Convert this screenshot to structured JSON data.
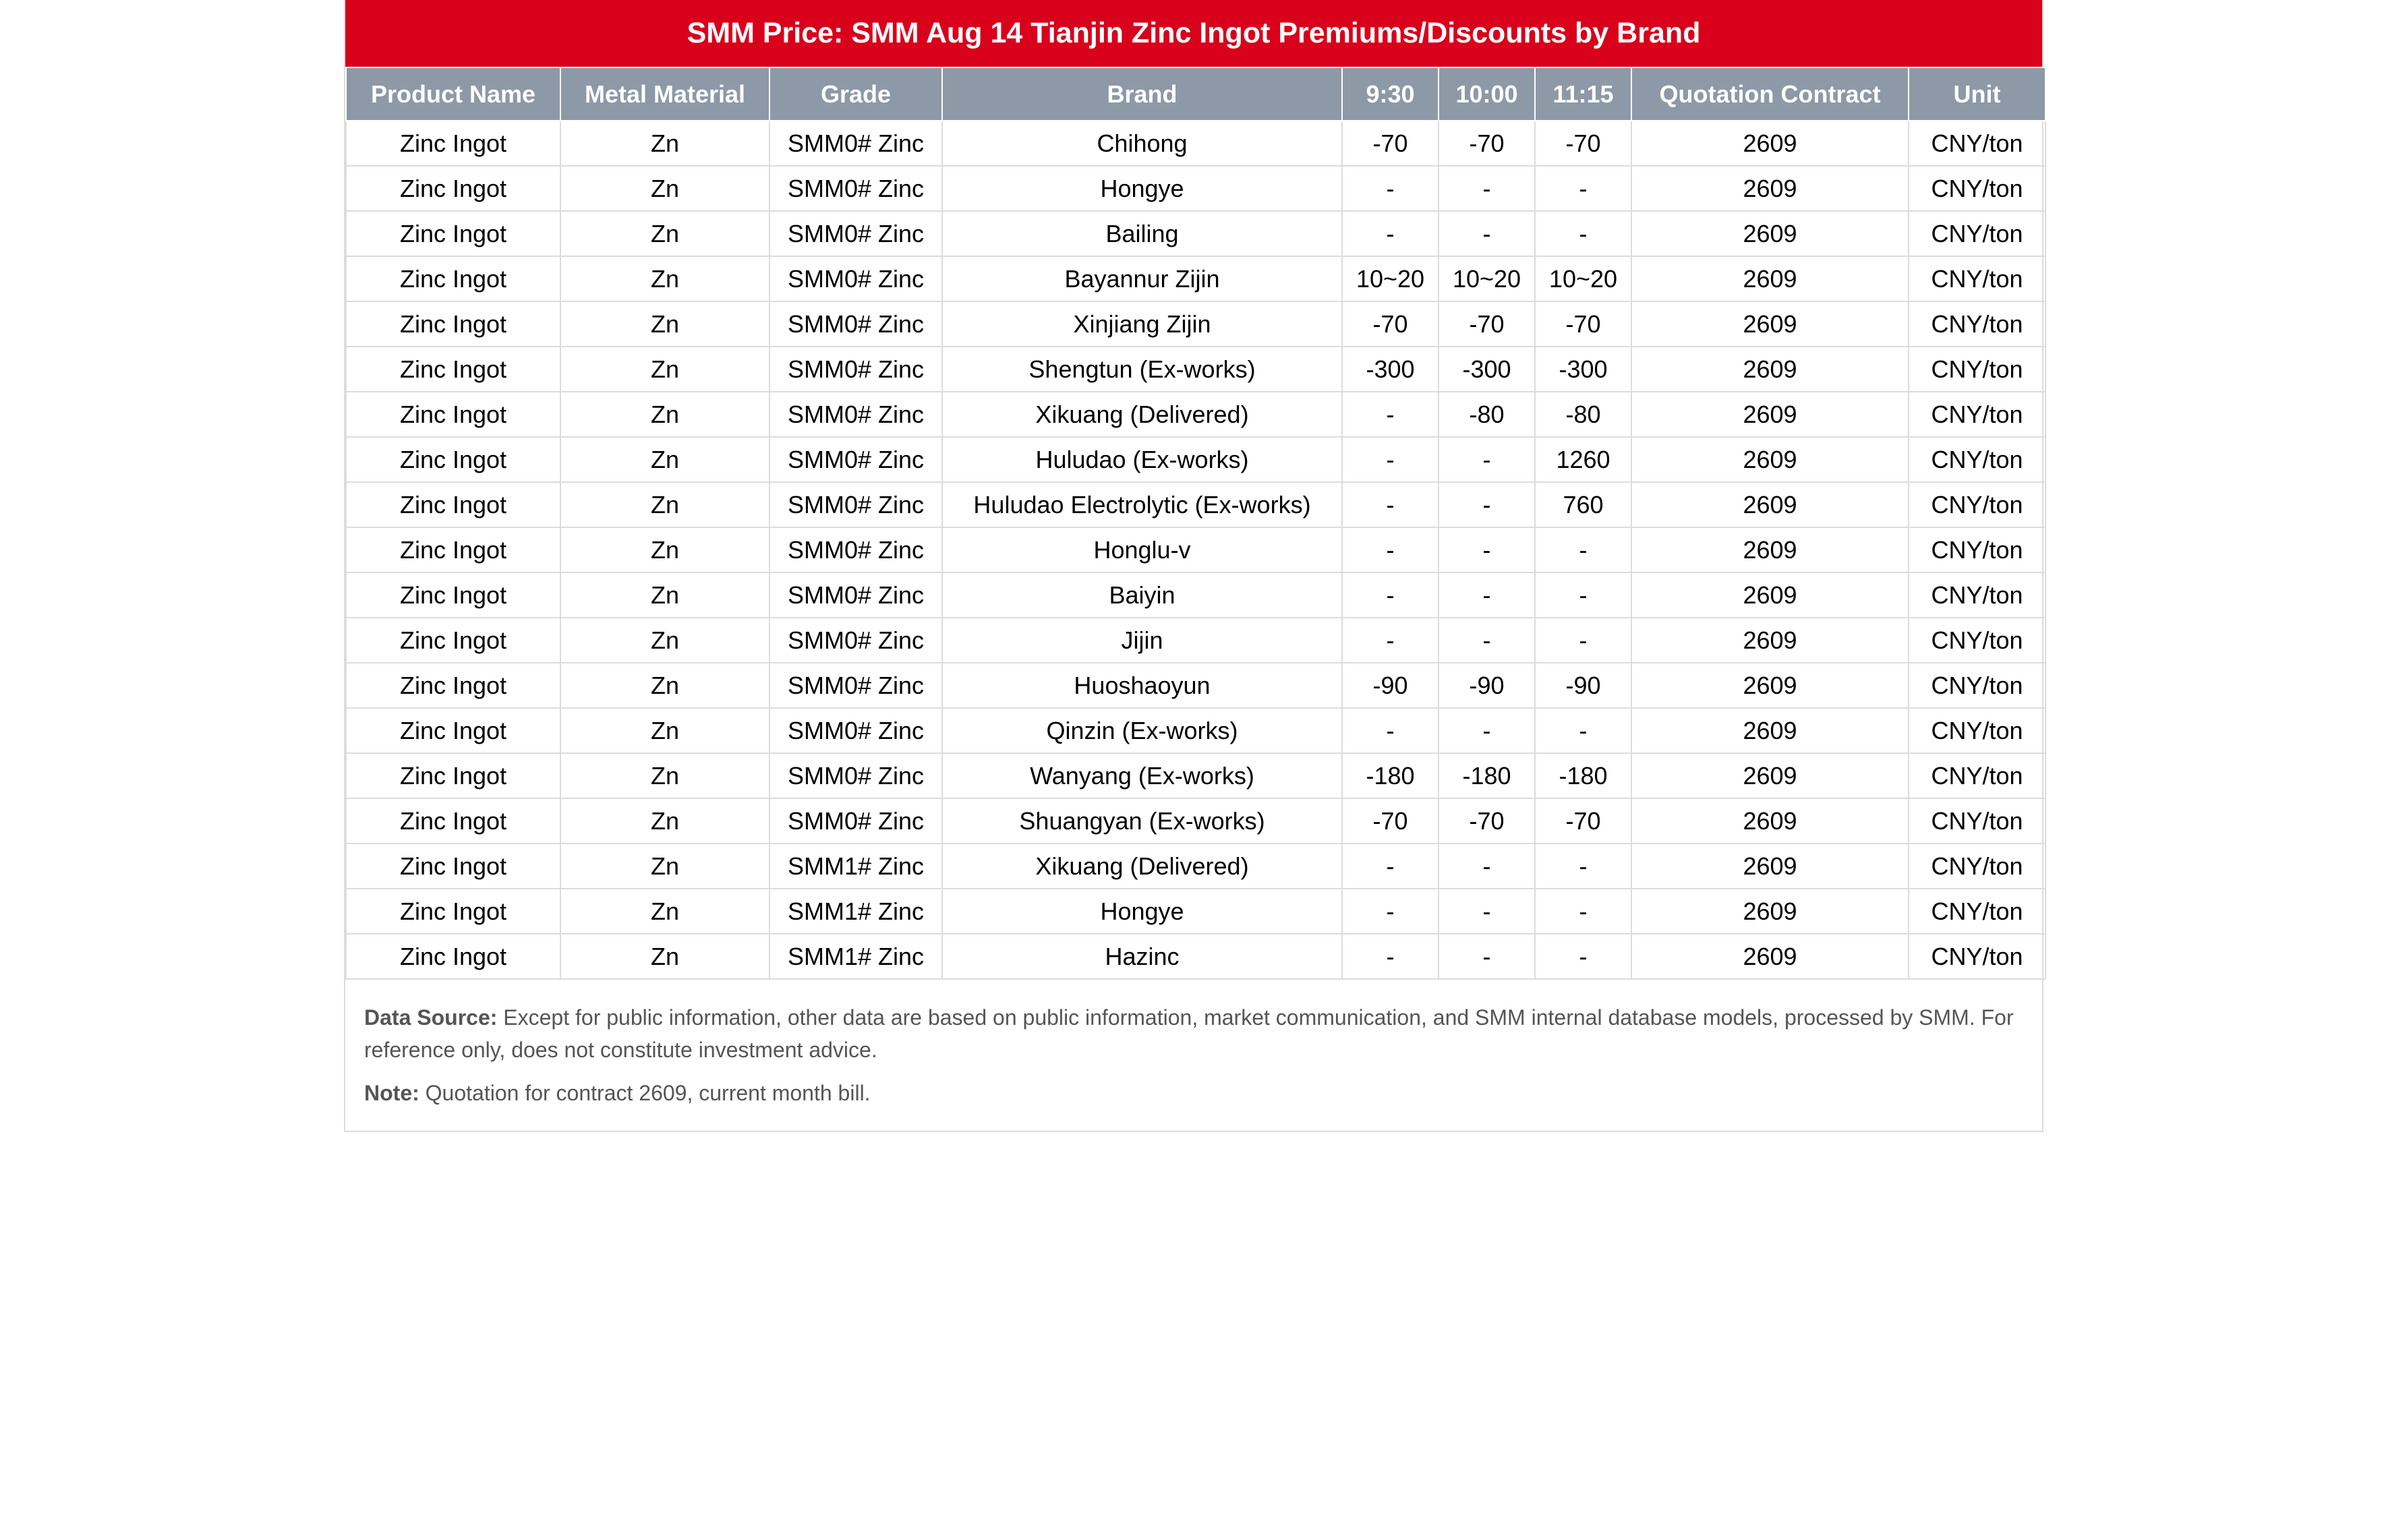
{
  "title": "SMM Price: SMM Aug 14 Tianjin Zinc Ingot Premiums/Discounts by Brand",
  "columns": [
    "Product Name",
    "Metal Material",
    "Grade",
    "Brand",
    "9:30",
    "10:00",
    "11:15",
    "Quotation Contract",
    "Unit"
  ],
  "rows": [
    [
      "Zinc Ingot",
      "Zn",
      "SMM0# Zinc",
      "Chihong",
      "-70",
      "-70",
      "-70",
      "2609",
      "CNY/ton"
    ],
    [
      "Zinc Ingot",
      "Zn",
      "SMM0# Zinc",
      "Hongye",
      "-",
      "-",
      "-",
      "2609",
      "CNY/ton"
    ],
    [
      "Zinc Ingot",
      "Zn",
      "SMM0# Zinc",
      "Bailing",
      "-",
      "-",
      "-",
      "2609",
      "CNY/ton"
    ],
    [
      "Zinc Ingot",
      "Zn",
      "SMM0# Zinc",
      "Bayannur Zijin",
      "10~20",
      "10~20",
      "10~20",
      "2609",
      "CNY/ton"
    ],
    [
      "Zinc Ingot",
      "Zn",
      "SMM0# Zinc",
      "Xinjiang Zijin",
      "-70",
      "-70",
      "-70",
      "2609",
      "CNY/ton"
    ],
    [
      "Zinc Ingot",
      "Zn",
      "SMM0# Zinc",
      "Shengtun (Ex-works)",
      "-300",
      "-300",
      "-300",
      "2609",
      "CNY/ton"
    ],
    [
      "Zinc Ingot",
      "Zn",
      "SMM0# Zinc",
      "Xikuang (Delivered)",
      "-",
      "-80",
      "-80",
      "2609",
      "CNY/ton"
    ],
    [
      "Zinc Ingot",
      "Zn",
      "SMM0# Zinc",
      "Huludao (Ex-works)",
      "-",
      "-",
      "1260",
      "2609",
      "CNY/ton"
    ],
    [
      "Zinc Ingot",
      "Zn",
      "SMM0# Zinc",
      "Huludao Electrolytic (Ex-works)",
      "-",
      "-",
      "760",
      "2609",
      "CNY/ton"
    ],
    [
      "Zinc Ingot",
      "Zn",
      "SMM0# Zinc",
      "Honglu-v",
      "-",
      "-",
      "-",
      "2609",
      "CNY/ton"
    ],
    [
      "Zinc Ingot",
      "Zn",
      "SMM0# Zinc",
      "Baiyin",
      "-",
      "-",
      "-",
      "2609",
      "CNY/ton"
    ],
    [
      "Zinc Ingot",
      "Zn",
      "SMM0# Zinc",
      "Jijin",
      "-",
      "-",
      "-",
      "2609",
      "CNY/ton"
    ],
    [
      "Zinc Ingot",
      "Zn",
      "SMM0# Zinc",
      "Huoshaoyun",
      "-90",
      "-90",
      "-90",
      "2609",
      "CNY/ton"
    ],
    [
      "Zinc Ingot",
      "Zn",
      "SMM0# Zinc",
      "Qinzin (Ex-works)",
      "-",
      "-",
      "-",
      "2609",
      "CNY/ton"
    ],
    [
      "Zinc Ingot",
      "Zn",
      "SMM0# Zinc",
      "Wanyang (Ex-works)",
      "-180",
      "-180",
      "-180",
      "2609",
      "CNY/ton"
    ],
    [
      "Zinc Ingot",
      "Zn",
      "SMM0# Zinc",
      "Shuangyan (Ex-works)",
      "-70",
      "-70",
      "-70",
      "2609",
      "CNY/ton"
    ],
    [
      "Zinc Ingot",
      "Zn",
      "SMM1# Zinc",
      "Xikuang (Delivered)",
      "-",
      "-",
      "-",
      "2609",
      "CNY/ton"
    ],
    [
      "Zinc Ingot",
      "Zn",
      "SMM1# Zinc",
      "Hongye",
      "-",
      "-",
      "-",
      "2609",
      "CNY/ton"
    ],
    [
      "Zinc Ingot",
      "Zn",
      "SMM1# Zinc",
      "Hazinc",
      "-",
      "-",
      "-",
      "2609",
      "CNY/ton"
    ]
  ],
  "footer": {
    "source_label": "Data Source:",
    "source_text": " Except for public information, other data are based on public information, market communication, and SMM internal database models, processed by SMM. For reference only, does not constitute investment advice.",
    "note_label": "Note:",
    "note_text": " Quotation for contract 2609, current month bill."
  },
  "colors": {
    "title_bg": "#d9001b",
    "header_bg": "#8d99a7"
  }
}
